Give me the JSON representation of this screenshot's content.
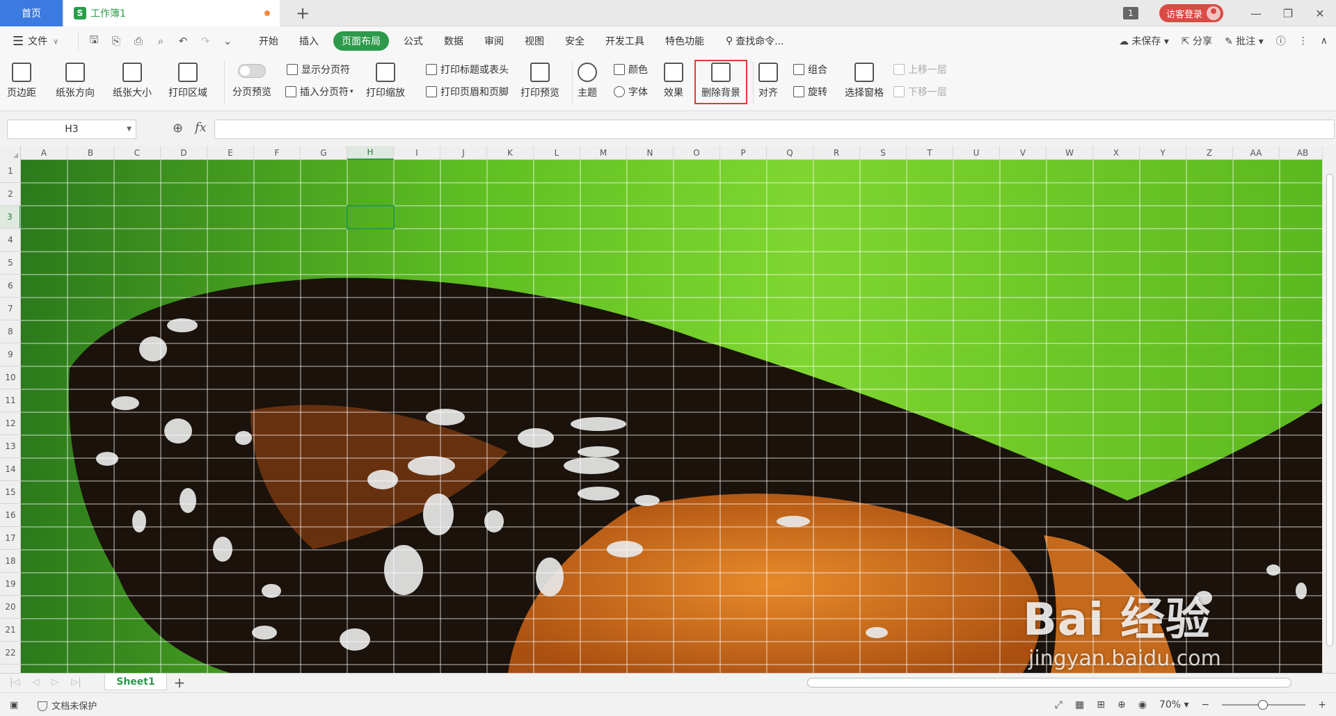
{
  "titlebar": {
    "home_tab": "首页",
    "doc_tab": "工作簿1",
    "doc_icon_letter": "S",
    "add_tab": "+",
    "window_count": "1",
    "login_label": "访客登录"
  },
  "menubar": {
    "file_label": "文件",
    "tabs": [
      "开始",
      "插入",
      "页面布局",
      "公式",
      "数据",
      "审阅",
      "视图",
      "安全",
      "开发工具",
      "特色功能"
    ],
    "active_tab": "页面布局",
    "search_label": "查找命令...",
    "unsaved_label": "未保存",
    "share_label": "分享",
    "comment_label": "批注"
  },
  "ribbon": {
    "margins": "页边距",
    "orientation": "纸张方向",
    "size": "纸张大小",
    "print_area": "打印区域",
    "page_break_preview": "分页预览",
    "show_page_breaks": "显示分页符",
    "insert_page_break": "插入分页符",
    "print_scaling": "打印缩放",
    "print_titles": "打印标题或表头",
    "print_header_footer": "打印页眉和页脚",
    "print_preview": "打印预览",
    "theme": "主题",
    "colors": "颜色",
    "fonts": "字体",
    "effects": "效果",
    "delete_background": "删除背景",
    "align": "对齐",
    "group": "组合",
    "rotate": "旋转",
    "selection_pane": "选择窗格",
    "bring_forward": "上移一层",
    "send_backward": "下移一层"
  },
  "formula": {
    "cell_ref": "H3",
    "fx": "fx",
    "value": ""
  },
  "grid": {
    "columns": [
      "A",
      "B",
      "C",
      "D",
      "E",
      "F",
      "G",
      "H",
      "I",
      "J",
      "K",
      "L",
      "M",
      "N",
      "O",
      "P",
      "Q",
      "R",
      "S",
      "T",
      "U",
      "V",
      "W",
      "X",
      "Y",
      "Z",
      "AA",
      "AB"
    ],
    "rows": [
      "1",
      "2",
      "3",
      "4",
      "5",
      "6",
      "7",
      "8",
      "9",
      "10",
      "11",
      "12",
      "13",
      "14",
      "15",
      "16",
      "17",
      "18",
      "19",
      "20",
      "21",
      "22"
    ],
    "selected_col": "H",
    "selected_row": "3"
  },
  "sheets": {
    "active": "Sheet1",
    "add": "+"
  },
  "status": {
    "doc_protect": "文档未保护",
    "zoom": "70%"
  },
  "watermark": {
    "brand": "Bai 经验",
    "url": "jingyan.baidu.com"
  },
  "colors": {
    "accent": "#2c9a4a",
    "home_tab": "#3b7be0",
    "highlight": "#e33a33",
    "login": "#d94b45"
  }
}
